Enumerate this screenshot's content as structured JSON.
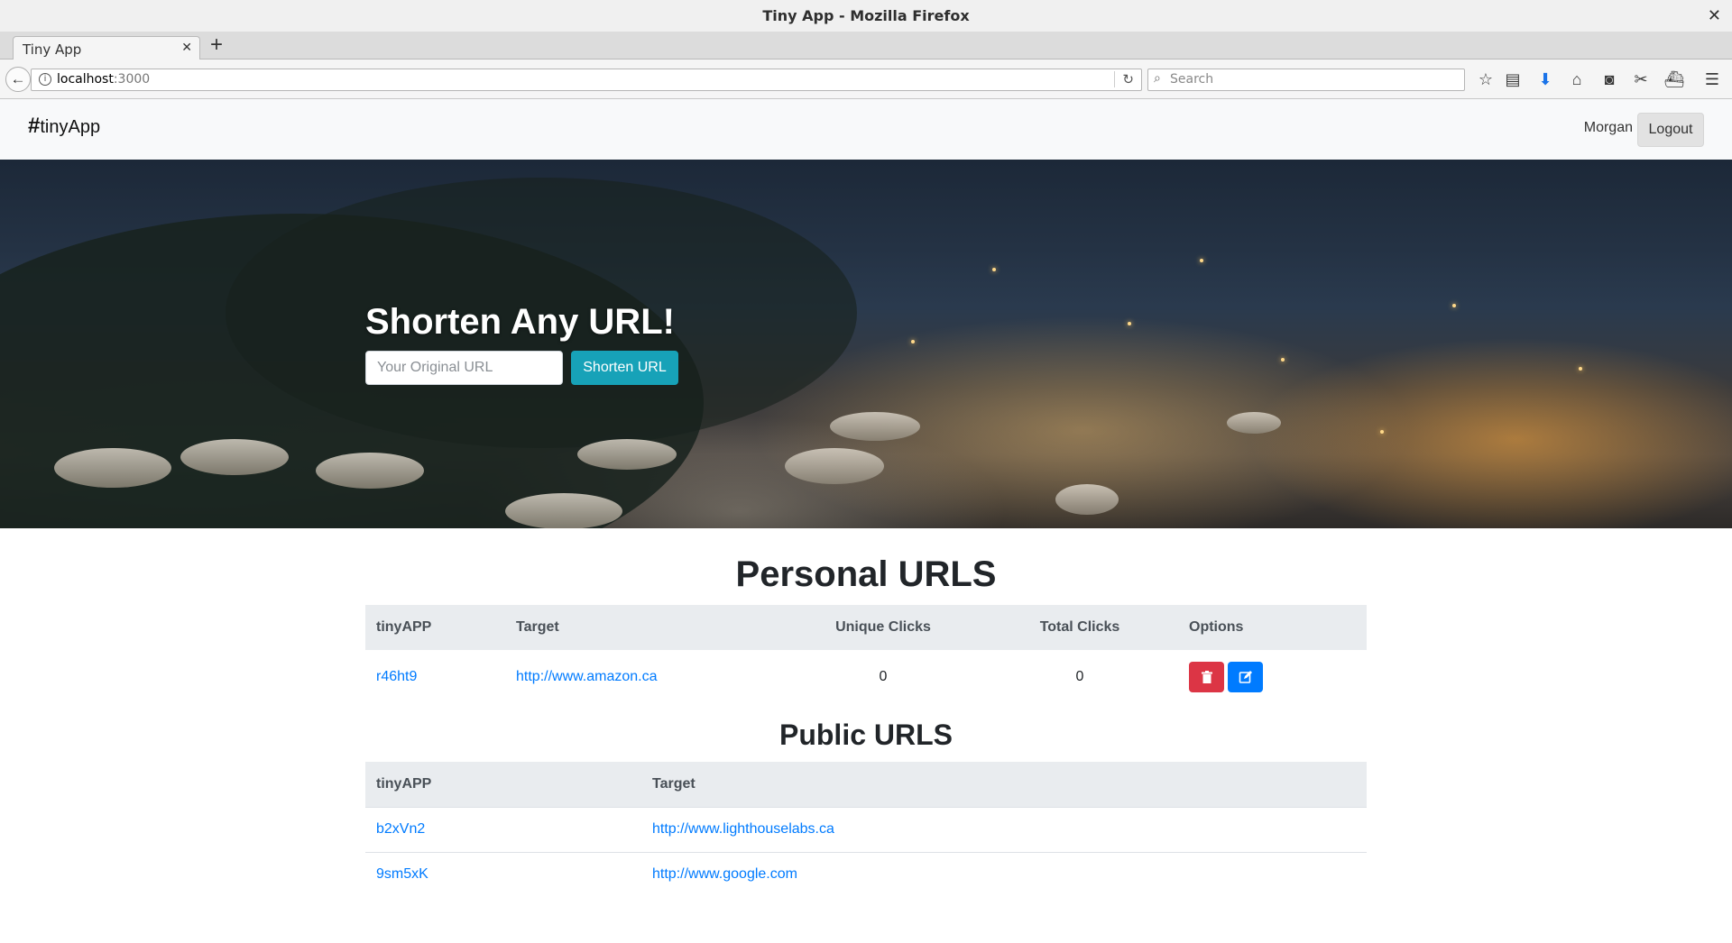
{
  "browser": {
    "window_title": "Tiny App - Mozilla Firefox",
    "tab_title": "Tiny App",
    "url_host": "localhost",
    "url_port": ":3000",
    "search_placeholder": "Search"
  },
  "nav": {
    "brand_hash": "#",
    "brand_name": "tinyApp",
    "user_name": "Morgan",
    "logout_label": "Logout"
  },
  "hero": {
    "title": "Shorten Any URL!",
    "input_placeholder": "Your Original URL",
    "button_label": "Shorten URL"
  },
  "personal": {
    "title": "Personal URLS",
    "headers": [
      "tinyAPP",
      "Target",
      "Unique Clicks",
      "Total Clicks",
      "Options"
    ],
    "rows": [
      {
        "short": "r46ht9",
        "target": "http://www.amazon.ca",
        "unique": "0",
        "total": "0"
      }
    ]
  },
  "public": {
    "title": "Public URLS",
    "headers": [
      "tinyAPP",
      "Target"
    ],
    "rows": [
      {
        "short": "b2xVn2",
        "target": "http://www.lighthouselabs.ca"
      },
      {
        "short": "9sm5xK",
        "target": "http://www.google.com"
      }
    ]
  },
  "colors": {
    "info": "#17a2b8",
    "danger": "#dc3545",
    "primary": "#007bff",
    "link": "#007bff"
  }
}
